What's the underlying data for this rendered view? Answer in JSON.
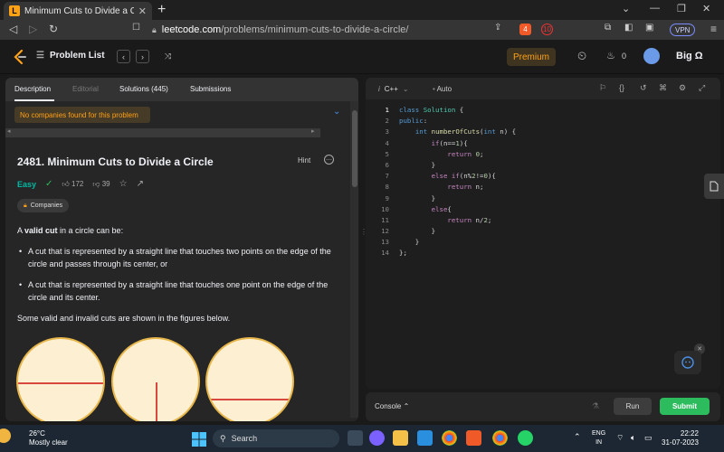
{
  "browser": {
    "tab_title": "Minimum Cuts to Divide a Circle",
    "url_host": "leetcode.com",
    "url_path": "/problems/minimum-cuts-to-divide-a-circle/",
    "vpn_label": "VPN",
    "brave_badge": "4",
    "alert_badge": "10"
  },
  "header": {
    "problem_list": "Problem List",
    "premium": "Premium",
    "streak": "0",
    "username": "Big Ω"
  },
  "left": {
    "tabs": [
      "Description",
      "Editorial",
      "Solutions (445)",
      "Submissions"
    ],
    "company_note": "No companies found for this problem",
    "title": "2481. Minimum Cuts to Divide a Circle",
    "hint": "Hint",
    "difficulty": "Easy",
    "likes": "172",
    "dislikes": "39",
    "companies": "Companies",
    "intro_pre": "A ",
    "intro_bold": "valid cut",
    "intro_post": " in a circle can be:",
    "bullets": [
      "A cut that is represented by a straight line that touches two points on the edge of the circle and passes through its center, or",
      "A cut that is represented by a straight line that touches one point on the edge of the circle and its center."
    ],
    "figures_note": "Some valid and invalid cuts are shown in the figures below."
  },
  "editor": {
    "language": "C++",
    "autocomplete": "Auto",
    "line_numbers": [
      "1",
      "2",
      "3",
      "4",
      "5",
      "6",
      "7",
      "8",
      "9",
      "10",
      "11",
      "12",
      "13",
      "14"
    ],
    "code_lines": [
      "class Solution {",
      "public:",
      "    int numberOfCuts(int n) {",
      "        if(n==1){",
      "            return 0;",
      "        }",
      "        else if(n%2!=0){",
      "            return n;",
      "        }",
      "        else{",
      "            return n/2;",
      "        }",
      "    }",
      "};"
    ],
    "console": "Console",
    "run": "Run",
    "submit": "Submit"
  },
  "taskbar": {
    "temperature": "26°C",
    "weather": "Mostly clear",
    "search": "Search",
    "lang1": "ENG",
    "lang2": "IN",
    "time": "22:22",
    "date": "31-07-2023"
  },
  "colors": {
    "easy": "#00b8a3",
    "premium": "#ffa116",
    "submit": "#2cbb5d"
  }
}
